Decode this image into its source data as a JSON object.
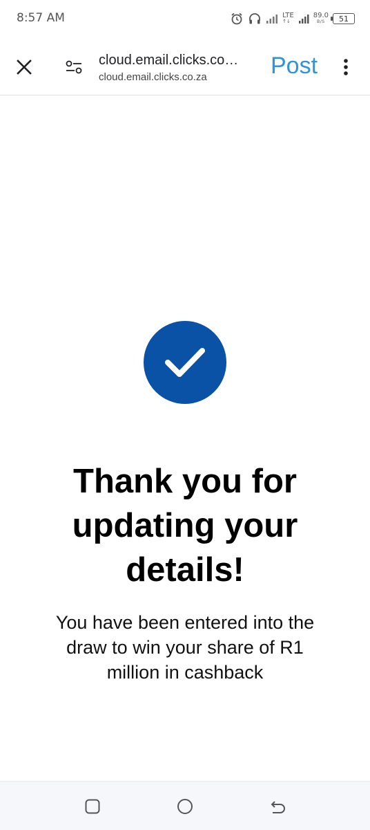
{
  "status_bar": {
    "time": "8:57 AM",
    "network": "LTE",
    "network_sub": "↑↓",
    "speed_value": "89.0",
    "speed_unit": "B/S",
    "battery": "51",
    "icons": [
      "alarm-icon",
      "headphones-icon",
      "signal-icon",
      "battery-icon"
    ]
  },
  "toolbar": {
    "url_title": "cloud.email.clicks.co…",
    "url_subtitle": "cloud.email.clicks.co.za",
    "post_label": "Post",
    "icons": [
      "close-icon",
      "tune-icon",
      "more-vert-icon"
    ],
    "accent_color": "#2d95d8"
  },
  "content": {
    "headline": "Thank you for updating your details!",
    "message": "You have been entered into the draw to win your share of R1 million in cashback",
    "check_color": "#0a52a5"
  },
  "nav_bar": {
    "icons": [
      "recents-icon",
      "home-icon",
      "back-icon"
    ]
  }
}
